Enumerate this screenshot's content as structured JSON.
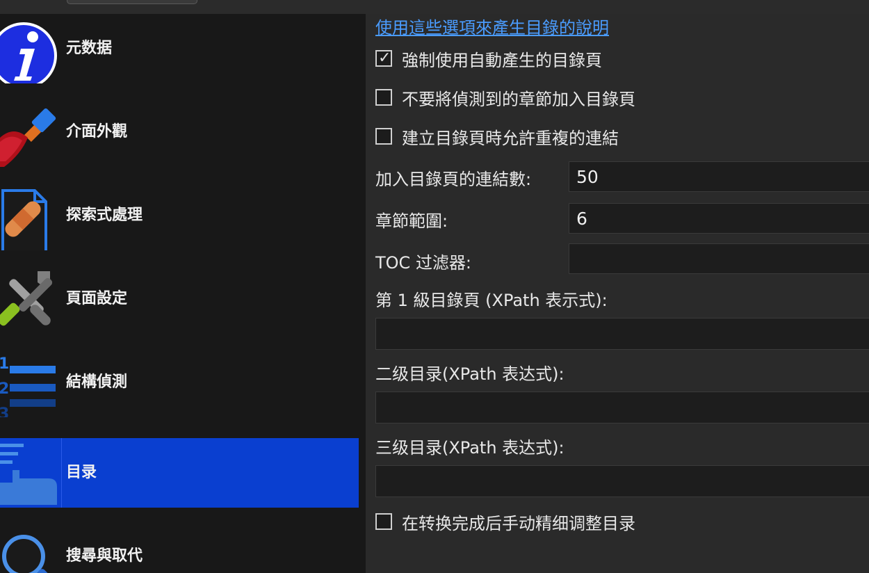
{
  "sidebar": {
    "items": [
      {
        "label": "元数据",
        "icon": "info-icon"
      },
      {
        "label": "介面外觀",
        "icon": "paintbrush-icon"
      },
      {
        "label": "探索式處理",
        "icon": "bandage-document-icon"
      },
      {
        "label": "頁面設定",
        "icon": "tools-icon"
      },
      {
        "label": "結構偵測",
        "icon": "numbered-list-icon"
      },
      {
        "label": "目录",
        "icon": "toc-hand-icon",
        "selected": true
      },
      {
        "label": "搜尋與取代",
        "icon": "magnifier-icon"
      }
    ]
  },
  "content": {
    "help_link": "使用這些選項來產生目錄的說明",
    "checkboxes": [
      {
        "label": "強制使用自動產生的目錄頁",
        "checked": true
      },
      {
        "label": "不要將偵測到的章節加入目錄頁",
        "checked": false
      },
      {
        "label": "建立目錄頁時允許重複的連結",
        "checked": false
      }
    ],
    "fields": {
      "max_links": {
        "label": "加入目錄頁的連結數:",
        "value": "50"
      },
      "chapter_threshold": {
        "label": "章節範圍:",
        "value": "6"
      },
      "toc_filter": {
        "label": "TOC 过滤器:",
        "value": ""
      },
      "level1": {
        "label": "第 1 級目錄頁 (XPath 表示式):",
        "value": ""
      },
      "level2": {
        "label": "二级目录(XPath 表达式):",
        "value": ""
      },
      "level3": {
        "label": "三级目录(XPath 表达式):",
        "value": ""
      }
    },
    "manual_fine_tune": {
      "label": "在转换完成后手动精细调整目录",
      "checked": false
    }
  },
  "colors": {
    "accent": "#0a3fd0",
    "link": "#4a9cff",
    "sidebar_bg": "#181818",
    "content_bg": "#2a2a2a"
  }
}
